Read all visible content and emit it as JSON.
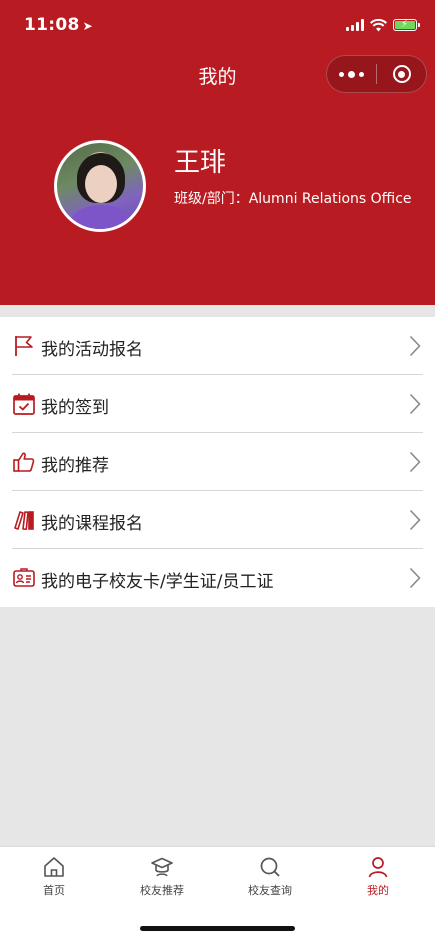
{
  "status_bar": {
    "time": "11:08"
  },
  "nav": {
    "title": "我的"
  },
  "profile": {
    "name": "王琲",
    "department": "班级/部门：Alumni Relations Office"
  },
  "menu": {
    "items": [
      {
        "label": "我的活动报名",
        "icon": "flag-icon"
      },
      {
        "label": "我的签到",
        "icon": "calendar-check-icon"
      },
      {
        "label": "我的推荐",
        "icon": "thumbs-up-icon"
      },
      {
        "label": "我的课程报名",
        "icon": "books-icon"
      },
      {
        "label": "我的电子校友卡/学生证/员工证",
        "icon": "id-card-icon"
      }
    ]
  },
  "tabbar": {
    "tabs": [
      {
        "label": "首页",
        "icon": "home-icon"
      },
      {
        "label": "校友推荐",
        "icon": "graduation-cap-icon"
      },
      {
        "label": "校友查询",
        "icon": "search-icon"
      },
      {
        "label": "我的",
        "icon": "person-icon",
        "active": true
      }
    ]
  },
  "colors": {
    "brand_red": "#b81c22",
    "background_gray": "#e6e6e6"
  }
}
